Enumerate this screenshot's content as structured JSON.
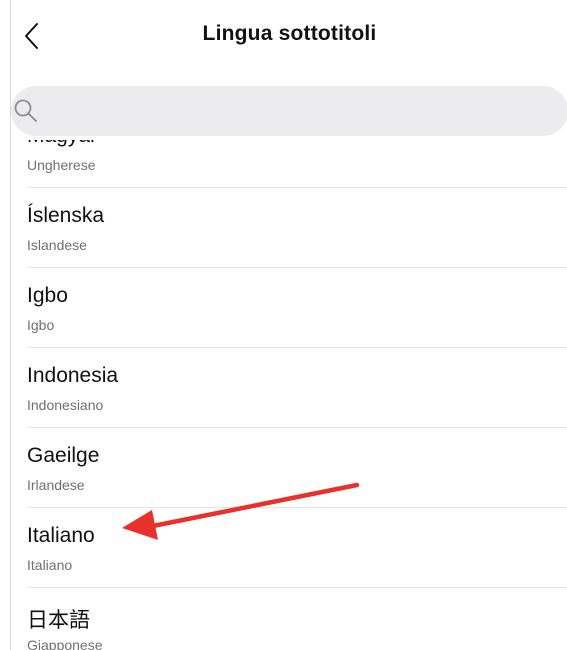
{
  "header": {
    "title": "Lingua sottotitoli"
  },
  "search": {
    "placeholder": ""
  },
  "languages": [
    {
      "name": "Magyar",
      "subtitle": "Ungherese"
    },
    {
      "name": "Íslenska",
      "subtitle": "Islandese"
    },
    {
      "name": "Igbo",
      "subtitle": "Igbo"
    },
    {
      "name": "Indonesia",
      "subtitle": "Indonesiano"
    },
    {
      "name": "Gaeilge",
      "subtitle": "Irlandese"
    },
    {
      "name": "Italiano",
      "subtitle": "Italiano"
    },
    {
      "name": "日本語",
      "subtitle": "Giapponese"
    }
  ],
  "colors": {
    "arrow": "#e8312a",
    "search_bg": "#ececee",
    "divider": "#e4e4e6"
  },
  "icons": {
    "back": "chevron-left-icon",
    "search": "search-icon",
    "annotation": "arrow-annotation-icon"
  }
}
